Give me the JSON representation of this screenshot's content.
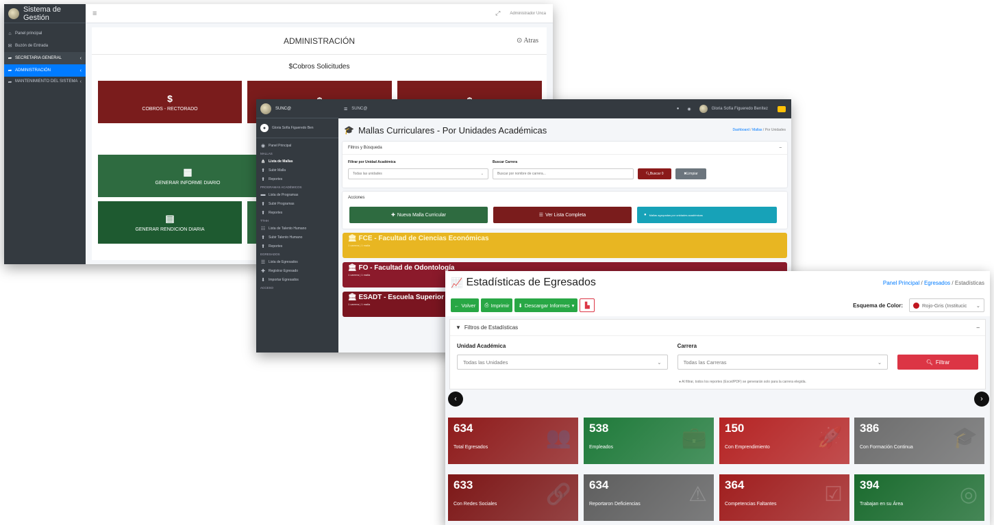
{
  "win1": {
    "brand": "Sistema de Gestión",
    "nav": [
      {
        "icon": "⌂",
        "label": "Panel principal"
      },
      {
        "icon": "✉",
        "label": "Buzón de Entrada"
      },
      {
        "icon": "➦",
        "label": "SECRETARIA GENERAL",
        "chev": "‹"
      },
      {
        "icon": "➦",
        "label": "ADMINISTRACIÓN",
        "chev": "‹"
      },
      {
        "icon": "➦",
        "label": "MANTENIMIENTO DEL SISTEMA",
        "chev": "‹"
      }
    ],
    "topbar_menu": "≡",
    "topbar_user": "Administrador Unca",
    "header_title": "ADMINISTRACIÓN",
    "back_label": "Atras",
    "subtitle": "$Cobros Solicitudes",
    "tiles": [
      {
        "icon": "$",
        "label": "COBROS - RECTORADO"
      },
      {
        "icon": "$",
        "label": ""
      },
      {
        "icon": "$",
        "label": ""
      },
      {
        "icon": "▦",
        "label": "GENERAR INFORME DIARIO"
      },
      {
        "icon": "▤",
        "label": "GENERAR RENDICION DIARIA"
      }
    ]
  },
  "win2": {
    "brand": "SUNC@",
    "user": "Gloria Sofía Figueredo Ben",
    "nav": [
      {
        "type": "item",
        "icon": "◉",
        "label": "Panel Principal"
      },
      {
        "type": "head",
        "label": "MALLAS"
      },
      {
        "type": "item",
        "icon": "⋔",
        "label": "Lista de Mallas",
        "bold": true
      },
      {
        "type": "item",
        "icon": "⬆",
        "label": "Subir Malla"
      },
      {
        "type": "item",
        "icon": "⬆",
        "label": "Reportes"
      },
      {
        "type": "head",
        "label": "PROGRAMAS ACADÉMICOS"
      },
      {
        "type": "item",
        "icon": "▬",
        "label": "Lista de Programas"
      },
      {
        "type": "item",
        "icon": "⬆",
        "label": "Subir Programas"
      },
      {
        "type": "item",
        "icon": "⬆",
        "label": "Reportes"
      },
      {
        "type": "head",
        "label": "TTHH"
      },
      {
        "type": "item",
        "icon": "☷",
        "label": "Lista de Talento Humano"
      },
      {
        "type": "item",
        "icon": "⬆",
        "label": "Subir Talento Humano"
      },
      {
        "type": "item",
        "icon": "⬆",
        "label": "Reportes"
      },
      {
        "type": "head",
        "label": "EGRESADOS"
      },
      {
        "type": "item",
        "icon": "☰",
        "label": "Lista de Egresados"
      },
      {
        "type": "item",
        "icon": "✚",
        "label": "Registrar Egresado"
      },
      {
        "type": "item",
        "icon": "⬇",
        "label": "Importar Egresados"
      },
      {
        "type": "head",
        "label": "ACCESO"
      }
    ],
    "topbar_label": "SUNC@",
    "topbar_user": "Gloria Sofía Figueredo Benítez",
    "title": "Mallas Curriculares - Por Unidades Académicas",
    "crumbs": [
      "Dashboard",
      "Mallas",
      "Por Unidades"
    ],
    "filters_title": "Filtros y Búsqueda",
    "filter_unit_label": "Filtrar por Unidad Académica",
    "filter_unit_value": "Todas las unidades",
    "search_label": "Buscar Carrera",
    "search_placeholder": "Buscar por nombre de carrera...",
    "search_btn": "Buscar 0",
    "clear_btn": "Limpiar",
    "actions_title": "Acciones",
    "action_new": "Nueva Malla Curricular",
    "action_list": "Ver Lista Completa",
    "action_info": "Mallas agrupadas por unidades académicas",
    "faculties": [
      {
        "name": "FCE - Facultad de Ciencias Económicas",
        "count": "1 carrera | 1 malla",
        "color": "#e8b622"
      },
      {
        "name": "FO - Facultad de Odontología",
        "count": "1 carrera | 1 malla",
        "color": "#8b1a2b"
      },
      {
        "name": "ESADT - Escuela Superior",
        "count": "1 carrera | 1 malla",
        "color": "#7a1520"
      }
    ]
  },
  "win3": {
    "title": "Estadísticas de Egresados",
    "crumbs": [
      "Panel Principal",
      "Egresados",
      "Estadísticas"
    ],
    "btn_back": "Volver",
    "btn_print": "Imprimir",
    "btn_download": "Descargar Informes",
    "schema_label": "Esquema de Color:",
    "schema_value": "Rojo-Gris (Institucic",
    "filters_title": "Filtros de Estadísticas",
    "unit_label": "Unidad Académica",
    "unit_value": "Todas las Unidades",
    "career_label": "Carrera",
    "career_value": "Todas las Carreras",
    "filter_btn": "Filtrar",
    "note": "Al filtrar, todos los reportes (Excel/PDF) se generarán solo para la carrera elegida.",
    "stats": [
      {
        "value": "634",
        "label": "Total Egresados",
        "color": "#8e1b1b",
        "icon": "👥"
      },
      {
        "value": "538",
        "label": "Empleados",
        "color": "#1f7a3a",
        "icon": "💼"
      },
      {
        "value": "150",
        "label": "Con Emprendimiento",
        "color": "#b52424",
        "icon": "🚀"
      },
      {
        "value": "386",
        "label": "Con Formación Continua",
        "color": "#6d6d6d",
        "icon": "🎓"
      },
      {
        "value": "633",
        "label": "Con Redes Sociales",
        "color": "#7d1717",
        "icon": "🔗"
      },
      {
        "value": "634",
        "label": "Reportaron Deficiencias",
        "color": "#5e5e5e",
        "icon": "⚠"
      },
      {
        "value": "364",
        "label": "Competencias Faltantes",
        "color": "#a01e1e",
        "icon": "☑"
      },
      {
        "value": "394",
        "label": "Trabajan en su Área",
        "color": "#1a6b2e",
        "icon": "◎"
      }
    ]
  }
}
